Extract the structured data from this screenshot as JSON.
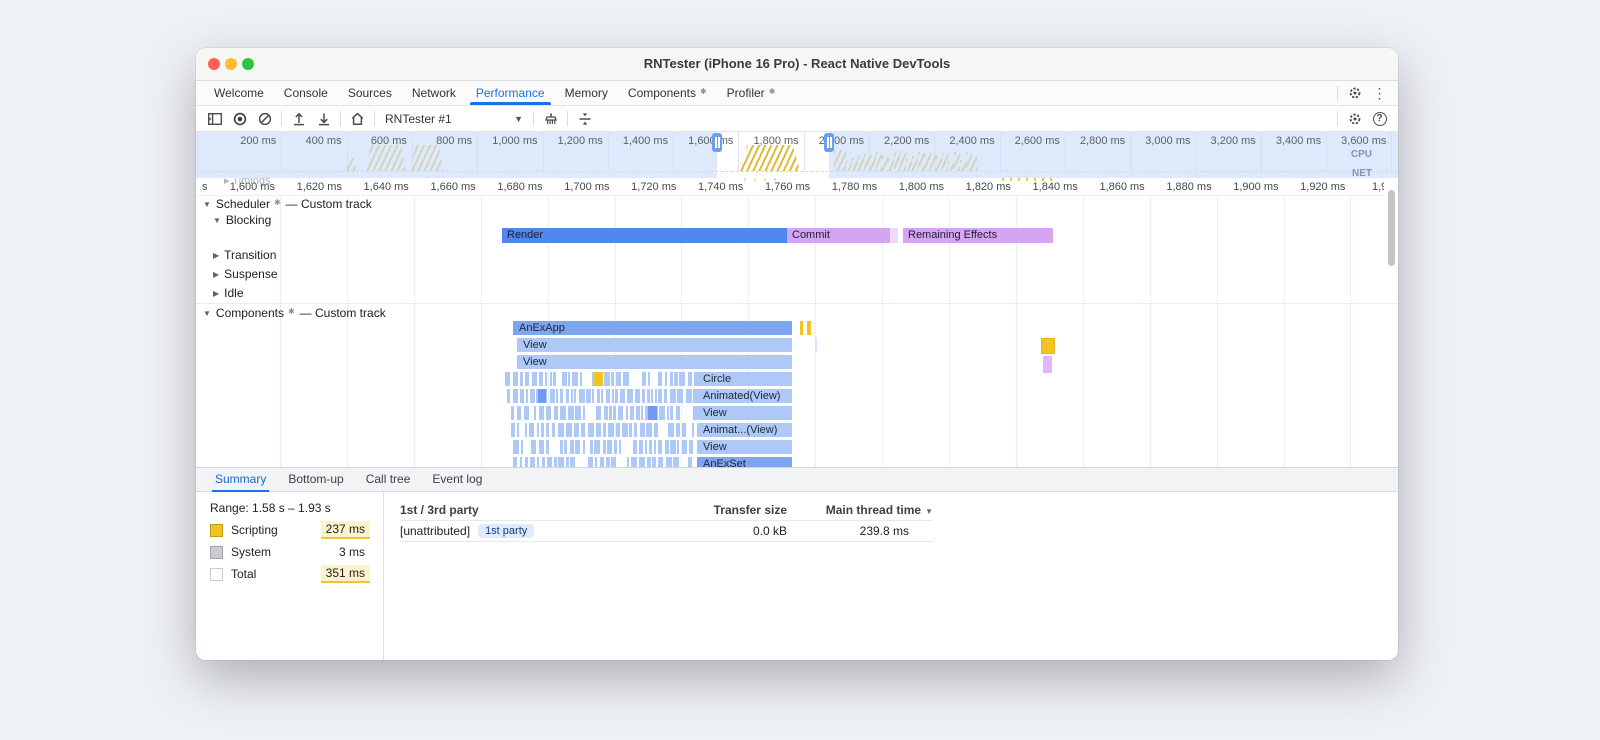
{
  "window": {
    "title": "RNTester (iPhone 16 Pro) - React Native DevTools"
  },
  "devtools_tabs": {
    "items": [
      {
        "label": "Welcome",
        "active": false,
        "badge": false
      },
      {
        "label": "Console",
        "active": false,
        "badge": false
      },
      {
        "label": "Sources",
        "active": false,
        "badge": false
      },
      {
        "label": "Network",
        "active": false,
        "badge": false
      },
      {
        "label": "Performance",
        "active": true,
        "badge": false
      },
      {
        "label": "Memory",
        "active": false,
        "badge": false
      },
      {
        "label": "Components",
        "active": false,
        "badge": true
      },
      {
        "label": "Profiler",
        "active": false,
        "badge": true
      }
    ]
  },
  "toolbar": {
    "target_selector": "RNTester #1"
  },
  "overview": {
    "tick_labels": [
      "200 ms",
      "400 ms",
      "600 ms",
      "800 ms",
      "1,000 ms",
      "1,200 ms",
      "1,400 ms",
      "1,600 ms",
      "1,800 ms",
      "2,000 ms",
      "2,200 ms",
      "2,400 ms",
      "2,600 ms",
      "2,800 ms",
      "3,000 ms",
      "3,200 ms",
      "3,400 ms",
      "3,600 ms"
    ],
    "cpu_label": "CPU",
    "net_label": "NET"
  },
  "ruler": {
    "leading_partial": "s",
    "tick_labels": [
      "1,600 ms",
      "1,620 ms",
      "1,640 ms",
      "1,660 ms",
      "1,680 ms",
      "1,700 ms",
      "1,720 ms",
      "1,740 ms",
      "1,760 ms",
      "1,780 ms",
      "1,800 ms",
      "1,820 ms",
      "1,840 ms",
      "1,860 ms",
      "1,880 ms",
      "1,900 ms",
      "1,920 ms"
    ],
    "trailing_partial": "1,9",
    "timings_ghost": "Timings"
  },
  "scheduler": {
    "label": "Scheduler",
    "suffix": "— Custom track",
    "lanes": [
      {
        "label": "Blocking",
        "expanded": true
      },
      {
        "label": "Transition",
        "expanded": false
      },
      {
        "label": "Suspense",
        "expanded": false
      },
      {
        "label": "Idle",
        "expanded": false
      }
    ],
    "events": [
      {
        "label": "Render"
      },
      {
        "label": "Commit"
      },
      {
        "label": "Remaining Effects"
      }
    ]
  },
  "components": {
    "label": "Components",
    "suffix": "— Custom track",
    "rows": [
      {
        "label": "AnExApp"
      },
      {
        "label": "View"
      },
      {
        "label": "View"
      },
      {
        "label": "Circle"
      },
      {
        "label": "Animated(View)"
      },
      {
        "label": "View"
      },
      {
        "label": "Animat...(View)"
      },
      {
        "label": "View"
      },
      {
        "label": "AnExSet"
      }
    ]
  },
  "bottom_tabs": {
    "items": [
      {
        "label": "Summary",
        "active": true
      },
      {
        "label": "Bottom-up",
        "active": false
      },
      {
        "label": "Call tree",
        "active": false
      },
      {
        "label": "Event log",
        "active": false
      }
    ]
  },
  "summary": {
    "range": "Range: 1.58 s – 1.93 s",
    "legend": [
      {
        "label": "Scripting",
        "value": "237 ms",
        "swatch": "#f3c41e",
        "highlight": true
      },
      {
        "label": "System",
        "value": "3 ms",
        "swatch": "#c9ccd1",
        "highlight": false
      },
      {
        "label": "Total",
        "value": "351 ms",
        "swatch": "#ffffff",
        "highlight": true
      }
    ],
    "table": {
      "col_party": "1st / 3rd party",
      "col_transfer": "Transfer size",
      "col_time": "Main thread time",
      "rows": [
        {
          "name": "[unattributed]",
          "badge": "1st party",
          "transfer": "0.0 kB",
          "time": "239.8 ms"
        }
      ]
    }
  },
  "icons": {
    "custom_panel_badge": "✱",
    "expanded_triangle": "▼",
    "collapsed_triangle": "▶",
    "sort_desc": "▼",
    "dropdown_chevron": "▼",
    "kebab": "⋮"
  },
  "colors": {
    "accent_blue": "#1a73e8",
    "render_blue": "#4e88ef",
    "commit_purple": "#d5a4f2",
    "commit_tail": "#eed9fa",
    "flame_mid_blue": "#7ea6ee",
    "flame_light_blue": "#aec9f7",
    "flame_accent_blue": "#6d9bf0",
    "scripting_yellow": "#f3c41e",
    "cpu_hatch_yellow": "#dfbb35",
    "selection_handle_blue": "#6d9eef",
    "short_purple": "#e2b6fa"
  }
}
